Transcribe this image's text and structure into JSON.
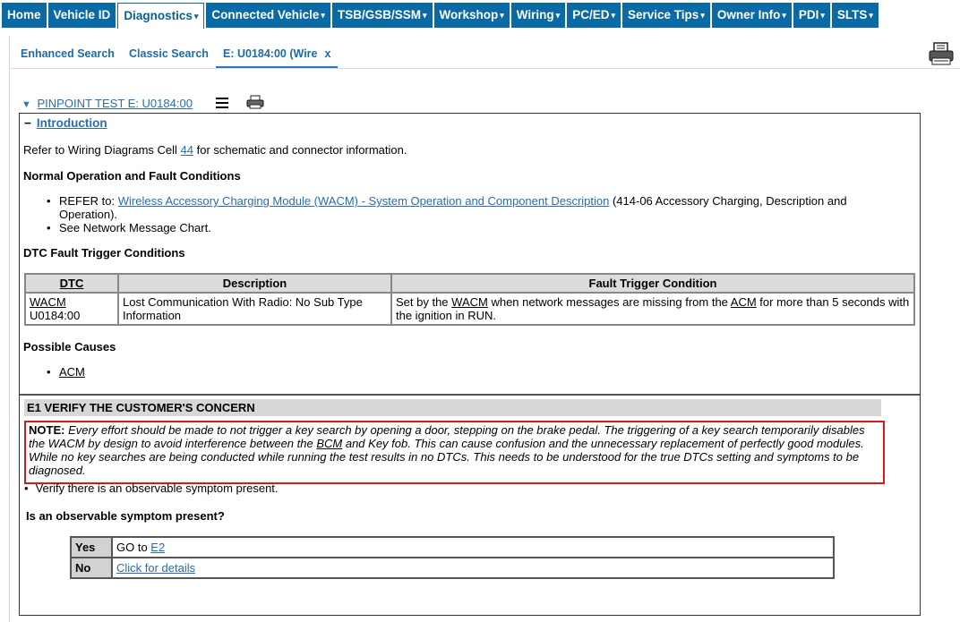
{
  "nav": {
    "items": [
      {
        "label": "Home",
        "dropdown": false
      },
      {
        "label": "Vehicle ID",
        "dropdown": false
      },
      {
        "label": "Diagnostics",
        "dropdown": true,
        "active": true
      },
      {
        "label": "Connected Vehicle",
        "dropdown": true
      },
      {
        "label": "TSB/GSB/SSM",
        "dropdown": true
      },
      {
        "label": "Workshop",
        "dropdown": true
      },
      {
        "label": "Wiring",
        "dropdown": true
      },
      {
        "label": "PC/ED",
        "dropdown": true
      },
      {
        "label": "Service Tips",
        "dropdown": true
      },
      {
        "label": "Owner Info",
        "dropdown": true
      },
      {
        "label": "PDI",
        "dropdown": true
      },
      {
        "label": "SLTS",
        "dropdown": true
      }
    ],
    "caret": "▾"
  },
  "tabs": [
    {
      "label": "Enhanced Search"
    },
    {
      "label": "Classic Search"
    },
    {
      "label": "E: U0184:00 (Wire",
      "close": "x",
      "active": true
    }
  ],
  "pinpoint": {
    "title": "PINPOINT TEST E: U0184:00",
    "arrow": "▼"
  },
  "intro": {
    "toggle": "−",
    "label": "Introduction",
    "refer_pre": "Refer to Wiring Diagrams Cell ",
    "refer_link": "44",
    "refer_post": " for schematic and connector information."
  },
  "normal_op": {
    "heading": "Normal Operation and Fault Conditions",
    "item1_pre": "REFER to: ",
    "item1_link": "Wireless Accessory Charging Module (WACM) - System Operation and Component Description",
    "item1_post": " (414-06 Accessory Charging, Description and Operation).",
    "item2": "See Network Message Chart."
  },
  "dtc_section": {
    "heading": "DTC Fault Trigger Conditions",
    "columns": [
      "DTC",
      "Description",
      "Fault Trigger Condition"
    ],
    "row": {
      "dtc_module": "WACM",
      "dtc_code": "U0184:00",
      "description": "Lost Communication With Radio: No Sub Type Information",
      "ftc_pre": "Set by the ",
      "ftc_wacm": "WACM",
      "ftc_mid": " when network messages are missing from the ",
      "ftc_acm": "ACM",
      "ftc_post": " for more than 5 seconds with the ignition in RUN."
    }
  },
  "causes": {
    "heading": "Possible Causes",
    "items": [
      "ACM"
    ]
  },
  "e1": {
    "heading": "E1 VERIFY THE CUSTOMER'S CONCERN",
    "note_label": "NOTE:",
    "note_pre": " Every effort should be made to not trigger a key search by opening a door, stepping on the brake pedal. The triggering of a key search temporarily disables the WACM by design to avoid interference between the ",
    "note_bcm": "BCM",
    "note_post": " and Key fob. This can cause confusion and the unnecessary replacement of perfectly good modules. While no key searches are being conducted while running the test results in no DTCs. This needs to be understood for the true DTCs setting and symptoms to be diagnosed.",
    "bullet": "•",
    "verify": "Verify there is an observable symptom present.",
    "question": "Is an observable symptom present?",
    "yes_label": "Yes",
    "yes_pre": "GO to ",
    "yes_link": "E2",
    "no_label": "No",
    "no_link": "Click for details"
  }
}
